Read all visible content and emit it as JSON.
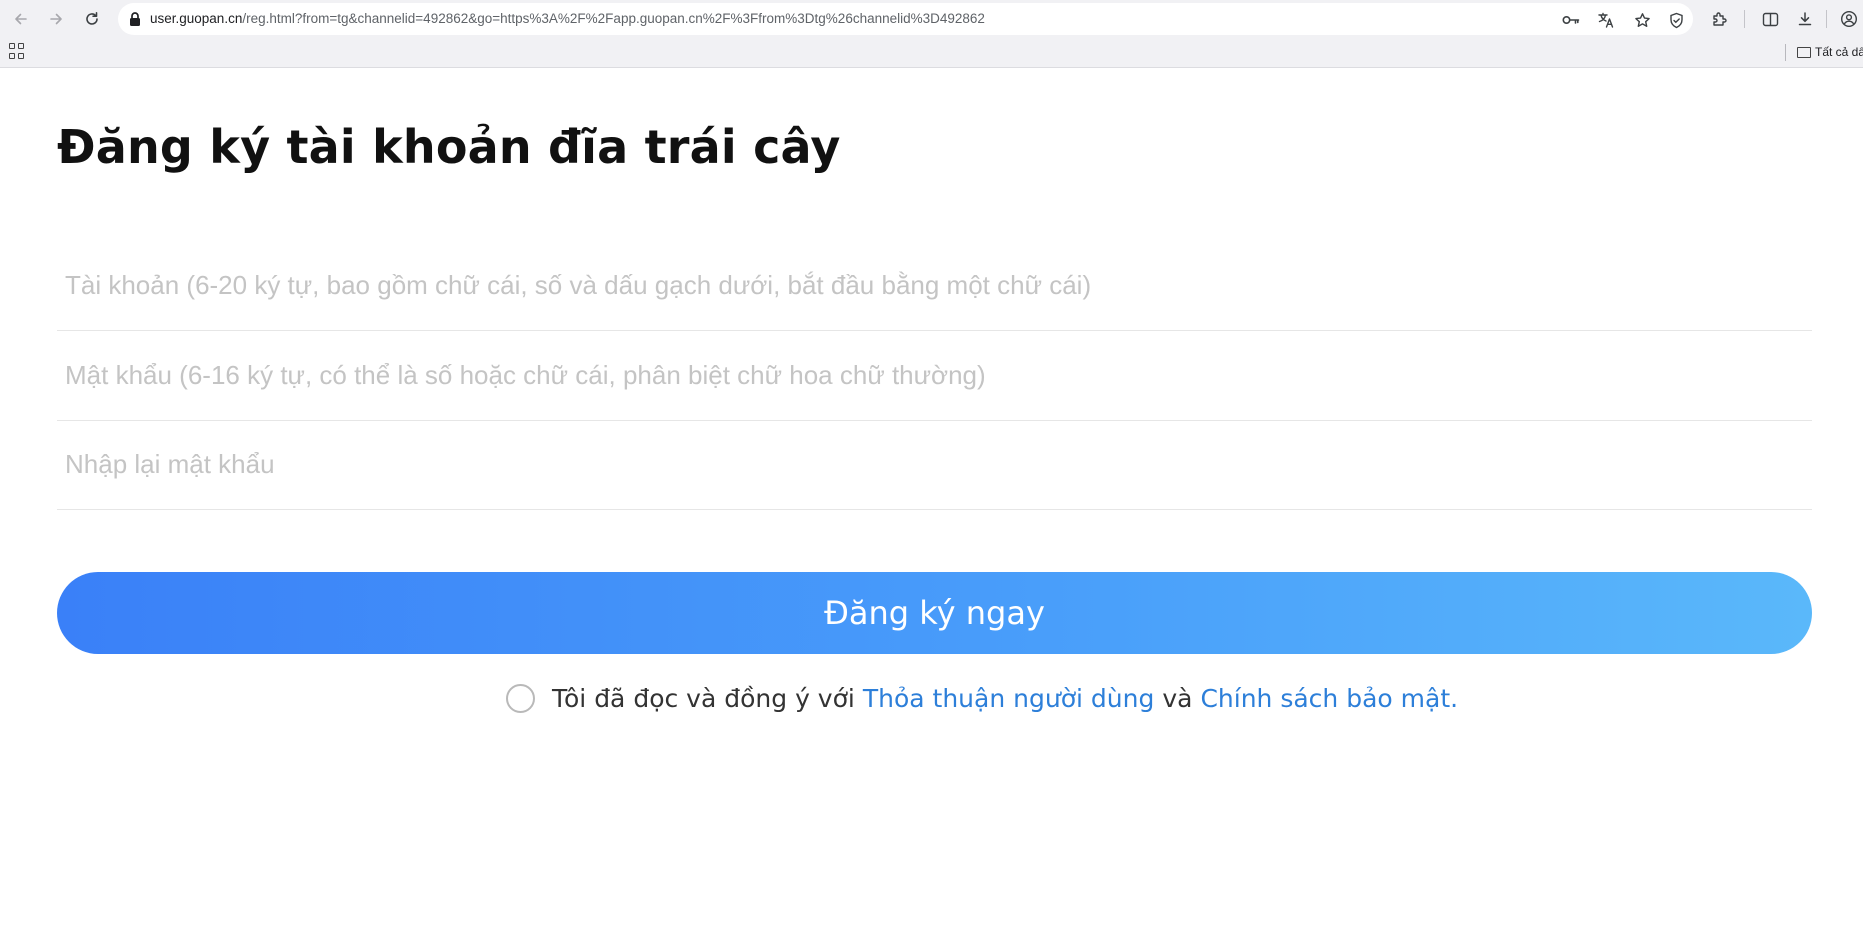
{
  "browser": {
    "url_host": "user.guopan.cn",
    "url_rest": "/reg.html?from=tg&channelid=492862&go=https%3A%2F%2Fapp.guopan.cn%2F%3Ffrom%3Dtg%26channelid%3D492862",
    "bookmark_folder_label": "Tất cả dấu trang",
    "icons": [
      "back-arrow-icon",
      "forward-arrow-icon",
      "reload-icon",
      "lock-icon",
      "key-icon",
      "translate-icon",
      "star-icon",
      "shield-icon",
      "extensions-icon",
      "split-screen-icon",
      "download-icon",
      "profile-icon",
      "apps-grid-icon",
      "folder-icon"
    ]
  },
  "page": {
    "title": "Đăng ký tài khoản đĩa trái cây",
    "fields": {
      "account_placeholder": "Tài khoản (6-20 ký tự, bao gồm chữ cái, số và dấu gạch dưới, bắt đầu bằng một chữ cái)",
      "password_placeholder": "Mật khẩu (6-16 ký tự, có thể là số hoặc chữ cái, phân biệt chữ hoa chữ thường)",
      "confirm_placeholder": "Nhập lại mật khẩu",
      "account_value": "",
      "password_value": "",
      "confirm_value": ""
    },
    "submit_label": "Đăng ký ngay",
    "agreement": {
      "prefix": "Tôi đã đọc và đồng ý với",
      "user_agreement": "Thỏa thuận người dùng",
      "conjunction": "và",
      "privacy_policy": "Chính sách bảo mật."
    }
  },
  "colors": {
    "button_gradient_start": "#3a80f8",
    "button_gradient_end": "#5ab8fa",
    "link": "#2d7fd9",
    "placeholder": "#c4c4c4"
  }
}
